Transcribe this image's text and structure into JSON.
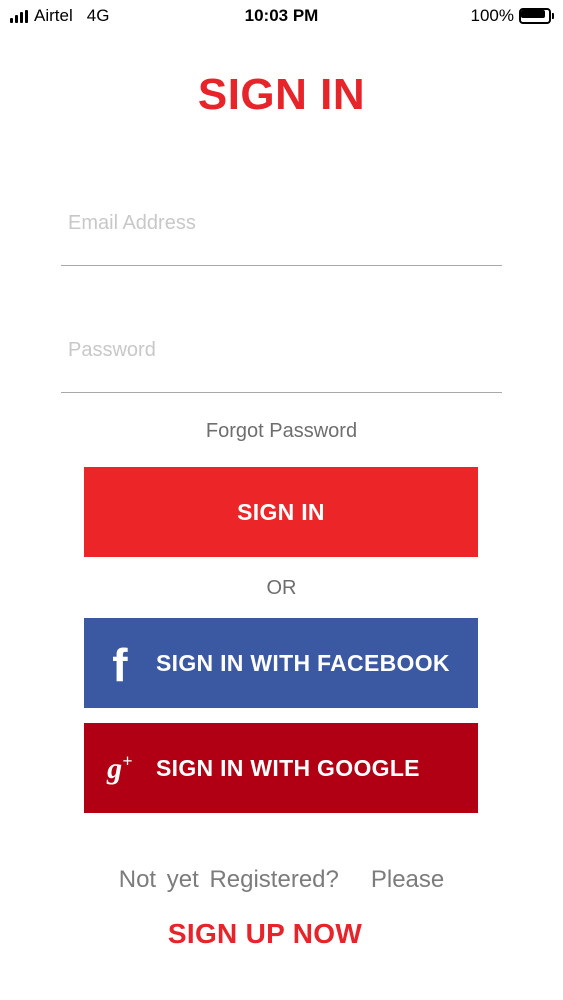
{
  "status_bar": {
    "carrier": "Airtel",
    "network": "4G",
    "time": "10:03 PM",
    "battery": "100%"
  },
  "title": "SIGN IN",
  "form": {
    "email_placeholder": "Email Address",
    "password_placeholder": "Password",
    "forgot_password": "Forgot Password"
  },
  "buttons": {
    "sign_in": "SIGN IN",
    "or": "OR",
    "facebook": "SIGN IN WITH FACEBOOK",
    "google": "SIGN IN WITH GOOGLE"
  },
  "footer": {
    "not_registered": "Not yet Registered?   Please",
    "sign_up": "SIGN UP NOW"
  },
  "colors": {
    "brand_red": "#e62429",
    "signin_button": "#ec2628",
    "facebook_button": "#3b58a3",
    "google_button": "#b10013"
  },
  "icons": {
    "facebook": "facebook-icon",
    "google": "google-plus-icon"
  }
}
